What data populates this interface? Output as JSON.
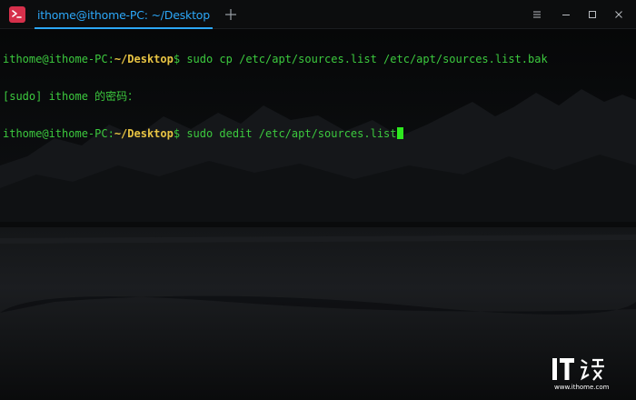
{
  "window": {
    "tab_title": "ithome@ithome-PC: ~/Desktop",
    "new_tab_icon": "plus-icon",
    "controls": [
      "menu-icon",
      "minimize-icon",
      "maximize-icon",
      "close-icon"
    ]
  },
  "terminal": {
    "line1": {
      "user": "ithome@ithome-PC",
      "sep": ":",
      "path": "~/Desktop",
      "prompt": "$ ",
      "command": "sudo cp /etc/apt/sources.list /etc/apt/sources.list.bak"
    },
    "line2": {
      "text": "[sudo] ithome 的密码："
    },
    "line3": {
      "user": "ithome@ithome-PC",
      "sep": ":",
      "path": "~/Desktop",
      "prompt": "$ ",
      "command": "sudo dedit /etc/apt/sources.list"
    }
  },
  "watermark": {
    "logo_text": "IT之家",
    "url": "www.ithome.com"
  },
  "colors": {
    "accent": "#2ca7f8",
    "prompt_green": "#3cc93e",
    "path_yellow": "#e8c443",
    "app_icon_red": "#d6304b"
  }
}
